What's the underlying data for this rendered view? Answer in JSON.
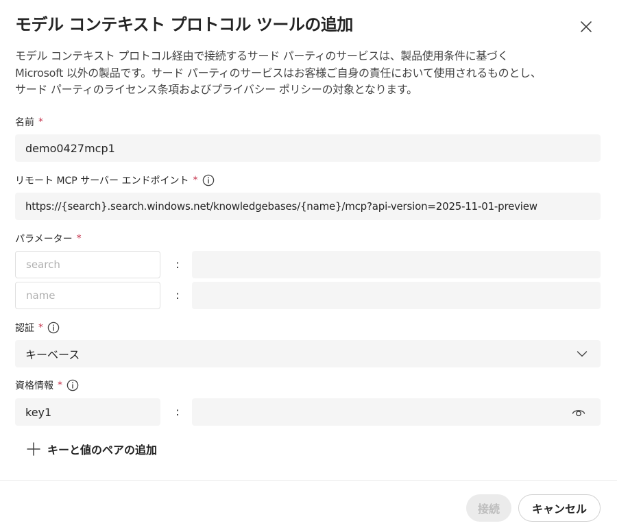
{
  "dialog": {
    "title": "モデル コンテキスト プロトコル ツールの追加",
    "description_lines": [
      "モデル コンテキスト プロトコル経由で接続するサード パーティのサービスは、製品使用条件に基づく",
      "Microsoft 以外の製品です。サード パーティのサービスはお客様ご自身の責任において使用されるものとし、",
      "サード パーティのライセンス条項およびプライバシー ポリシーの対象となります。"
    ]
  },
  "form": {
    "required_mark": "*",
    "name": {
      "label": "名前",
      "value": "demo0427mcp1"
    },
    "endpoint": {
      "label": "リモート MCP サーバー エンドポイント",
      "value": "https://{search}.search.windows.net/knowledgebases/{name}/mcp?api-version=2025-11-01-preview"
    },
    "parameters": {
      "label": "パラメーター",
      "separator": ":",
      "rows": [
        {
          "key_placeholder": "search",
          "value": ""
        },
        {
          "key_placeholder": "name",
          "value": ""
        }
      ]
    },
    "auth": {
      "label": "認証",
      "selected": "キーベース"
    },
    "credentials": {
      "label": "資格情報",
      "separator": ":",
      "key": "key1",
      "value": ""
    },
    "add_pair_label": "キーと値のペアの追加"
  },
  "footer": {
    "connect_label": "接続",
    "cancel_label": "キャンセル"
  },
  "colors": {
    "required": "#c4314b",
    "field_bg": "#f5f5f5",
    "disabled_text": "#bdbdbd"
  },
  "icons": {
    "close": "close-icon",
    "info": "info-icon",
    "chevron": "chevron-down-icon",
    "eye": "eye-icon",
    "plus": "plus-icon"
  }
}
